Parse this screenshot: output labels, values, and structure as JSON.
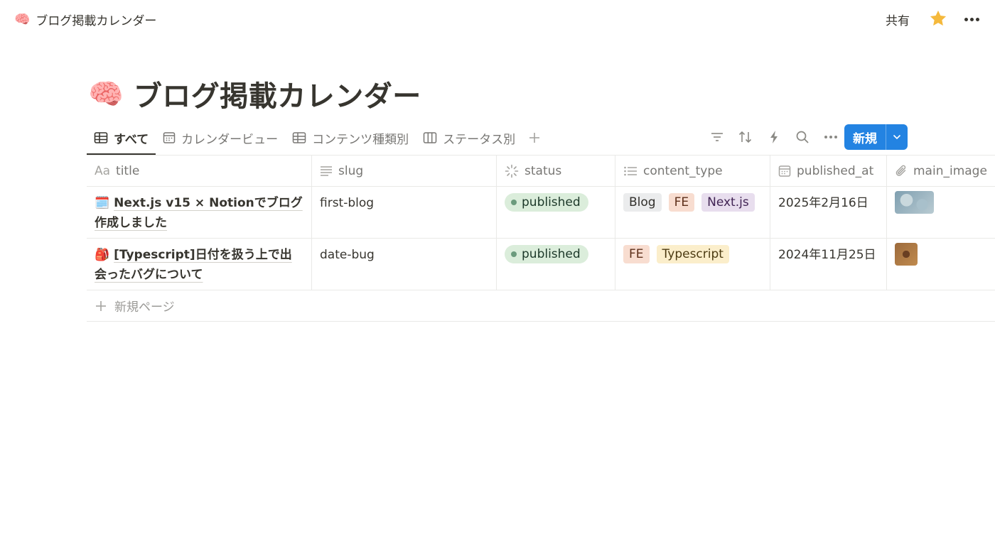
{
  "topbar": {
    "breadcrumb_emoji": "🧠",
    "breadcrumb_title": "ブログ掲載カレンダー",
    "share_label": "共有",
    "favorite_icon": "star-icon",
    "more_icon": "more-horizontal-icon"
  },
  "page": {
    "emoji": "🧠",
    "title": "ブログ掲載カレンダー"
  },
  "views": [
    {
      "label": "すべて",
      "icon": "table-icon",
      "active": true
    },
    {
      "label": "カレンダービュー",
      "icon": "calendar-icon",
      "active": false
    },
    {
      "label": "コンテンツ種類別",
      "icon": "table-icon",
      "active": false
    },
    {
      "label": "ステータス別",
      "icon": "board-icon",
      "active": false
    }
  ],
  "toolbar": {
    "icons": [
      "filter-icon",
      "sort-icon",
      "automation-icon",
      "search-icon",
      "more-horizontal-icon"
    ],
    "new_label": "新規",
    "accent": "#2383e2"
  },
  "table": {
    "columns": [
      {
        "label": "title",
        "prefix": "Aa",
        "icon": "text-title-icon"
      },
      {
        "label": "slug",
        "icon": "text-lines-icon"
      },
      {
        "label": "status",
        "icon": "status-icon"
      },
      {
        "label": "content_type",
        "icon": "multi-select-icon"
      },
      {
        "label": "published_at",
        "icon": "calendar-icon"
      },
      {
        "label": "main_image",
        "icon": "paperclip-icon"
      }
    ],
    "rows": [
      {
        "emoji": "🗓️",
        "title": "Next.js v15 × Notionでブログ作成しました",
        "slug": "first-blog",
        "status": "published",
        "tags": [
          {
            "label": "Blog",
            "bg": "#ebeced",
            "fg": "#32302c"
          },
          {
            "label": "FE",
            "bg": "#f8ddd0",
            "fg": "#5d2f1a"
          },
          {
            "label": "Next.js",
            "bg": "#e8deee",
            "fg": "#412454"
          }
        ],
        "published_at": "2025年2月16日",
        "image_colors": [
          "#7f9fb0",
          "#b9cbd2"
        ]
      },
      {
        "emoji": "🎒",
        "title": "[Typescript]日付を扱う上で出会ったバグについて",
        "slug": "date-bug",
        "status": "published",
        "tags": [
          {
            "label": "FE",
            "bg": "#f8ddd0",
            "fg": "#5d2f1a"
          },
          {
            "label": "Typescript",
            "bg": "#fbeecb",
            "fg": "#4c3b12"
          }
        ],
        "published_at": "2024年11月25日",
        "image_colors": [
          "#9c6a3c",
          "#c08a4e"
        ]
      }
    ],
    "new_page_label": "新規ページ"
  },
  "colors": {
    "status_published_bg": "#dbeddb",
    "status_published_dot": "#6c9b7d"
  }
}
